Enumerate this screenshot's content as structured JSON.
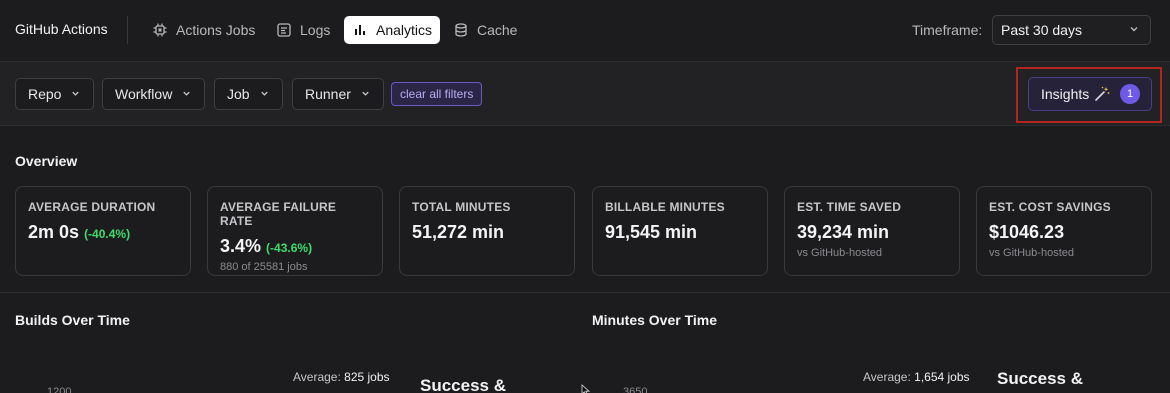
{
  "header": {
    "brand": "GitHub Actions",
    "nav": [
      {
        "label": "Actions Jobs",
        "icon": "chip-icon"
      },
      {
        "label": "Logs",
        "icon": "logs-icon"
      },
      {
        "label": "Analytics",
        "icon": "bar-chart-icon",
        "active": true
      },
      {
        "label": "Cache",
        "icon": "database-icon"
      }
    ],
    "timeframe_label": "Timeframe:",
    "timeframe_value": "Past 30 days"
  },
  "filters": {
    "items": [
      "Repo",
      "Workflow",
      "Job",
      "Runner"
    ],
    "clear_label": "clear all filters",
    "insights_label": "Insights",
    "insights_count": "1"
  },
  "overview": {
    "title": "Overview",
    "cards": [
      {
        "label": "AVERAGE DURATION",
        "value": "2m 0s",
        "delta": "(-40.4%)",
        "sub": ""
      },
      {
        "label": "AVERAGE FAILURE RATE",
        "value": "3.4%",
        "delta": "(-43.6%)",
        "sub": "880 of 25581 jobs"
      },
      {
        "label": "TOTAL MINUTES",
        "value": "51,272 min",
        "delta": "",
        "sub": ""
      },
      {
        "label": "BILLABLE MINUTES",
        "value": "91,545 min",
        "delta": "",
        "sub": ""
      },
      {
        "label": "EST. TIME SAVED",
        "value": "39,234 min",
        "delta": "",
        "sub": "vs GitHub-hosted"
      },
      {
        "label": "EST. COST SAVINGS",
        "value": "$1046.23",
        "delta": "",
        "sub": "vs GitHub-hosted"
      }
    ]
  },
  "builds_chart": {
    "title": "Builds Over Time",
    "avg_label": "Average:",
    "avg_value": "825 jobs",
    "legend_title": "Success &",
    "y_tick_top": "1200"
  },
  "minutes_chart": {
    "title": "Minutes Over Time",
    "avg_label": "Average:",
    "avg_value": "1,654 jobs",
    "legend_title": "Success &",
    "y_tick_top": "3650"
  },
  "colors": {
    "accent": "#6d5ae6",
    "positive": "#3ddc6d",
    "highlight_frame": "#b3261e"
  }
}
